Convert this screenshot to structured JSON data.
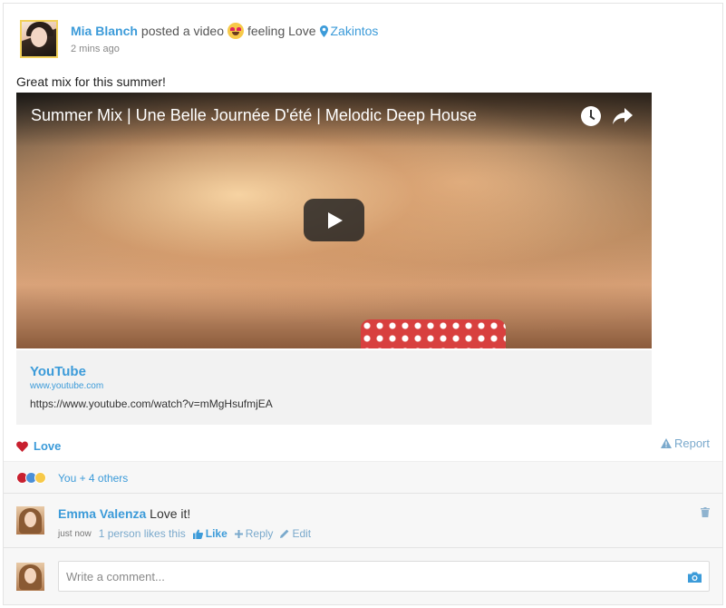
{
  "post": {
    "author": "Mia Blanch",
    "action_text": "posted a video",
    "feeling_text": "feeling Love",
    "location": "Zakintos",
    "timestamp": "2 mins ago",
    "body_text": "Great mix for this summer!"
  },
  "video": {
    "title": "Summer Mix | Une Belle Journée D'été | Melodic Deep House",
    "icons": [
      "clock-icon",
      "share-icon",
      "play-icon"
    ]
  },
  "link_preview": {
    "title": "YouTube",
    "domain": "www.youtube.com",
    "url": "https://www.youtube.com/watch?v=mMgHsufmjEA"
  },
  "actions": {
    "love_label": "Love",
    "report_label": "Report"
  },
  "reactions": {
    "summary": "You + 4 others",
    "icons": [
      "heart-icon",
      "like-icon",
      "wow-icon"
    ]
  },
  "comment": {
    "author": "Emma Valenza",
    "text": "Love it!",
    "time": "just now",
    "likes_text": "1 person likes this",
    "like_label": "Like",
    "reply_label": "Reply",
    "edit_label": "Edit"
  },
  "composer": {
    "placeholder": "Write a comment..."
  },
  "colors": {
    "accent": "#3c9bd9",
    "heart": "#c8202f",
    "muted_link": "#7aa9cc"
  }
}
